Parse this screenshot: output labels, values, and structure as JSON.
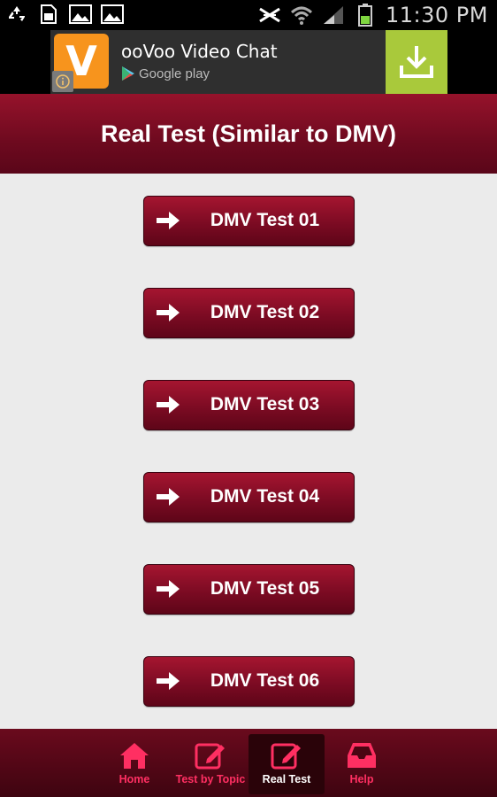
{
  "status_bar": {
    "time": "11:30 PM",
    "left_icons": [
      "recycle-icon",
      "sim-card-icon",
      "image-icon",
      "image-icon"
    ],
    "right_icons": [
      "signal-muted-icon",
      "wifi-icon",
      "cell-signal-icon",
      "battery-icon"
    ]
  },
  "ad": {
    "logo_letter": "V",
    "title": "ooVoo Video Chat",
    "store_label": "Google play",
    "accent": "#f7941d",
    "download_color": "#a9c93b"
  },
  "header": {
    "title": "Real Test (Similar to DMV)"
  },
  "tests": [
    {
      "label": "DMV Test 01"
    },
    {
      "label": "DMV Test 02"
    },
    {
      "label": "DMV Test 03"
    },
    {
      "label": "DMV Test 04"
    },
    {
      "label": "DMV Test 05"
    },
    {
      "label": "DMV Test 06"
    }
  ],
  "nav": {
    "items": [
      {
        "label": "Home",
        "icon": "home-icon",
        "active": false
      },
      {
        "label": "Test by Topic",
        "icon": "edit-icon",
        "active": false
      },
      {
        "label": "Real Test",
        "icon": "edit-icon",
        "active": true
      },
      {
        "label": "Help",
        "icon": "inbox-icon",
        "active": false
      }
    ]
  },
  "colors": {
    "primary": "#7c0b23",
    "nav_accent": "#ff2f62",
    "background": "#ebebeb"
  }
}
